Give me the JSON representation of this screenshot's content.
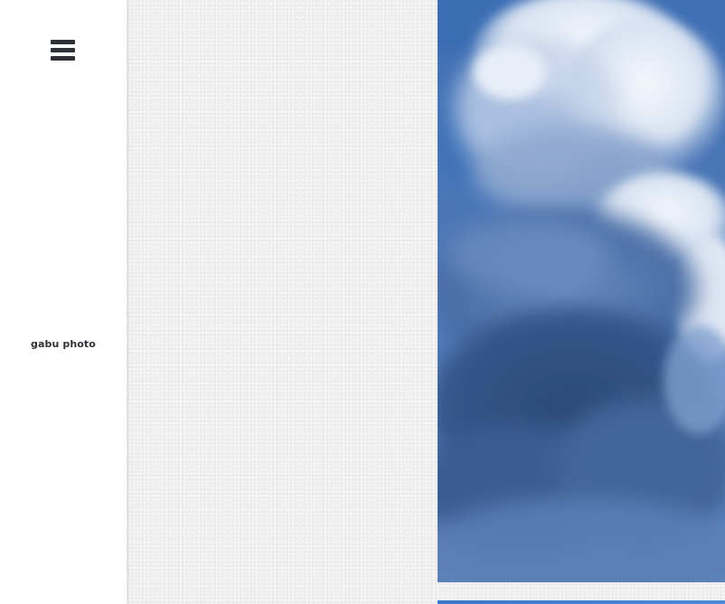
{
  "sidebar": {
    "menu_icon": "hamburger-menu-icon",
    "brand": "gabu photo"
  },
  "content": {
    "photo_subject": "cloudy-sky-image",
    "colors": {
      "sky": "#4a75b8",
      "cloud_light": "#eef3fa",
      "cloud_shadow": "#2f4f7f",
      "page_bg": "#f1f1f1",
      "strip": "#3b77c9"
    }
  }
}
